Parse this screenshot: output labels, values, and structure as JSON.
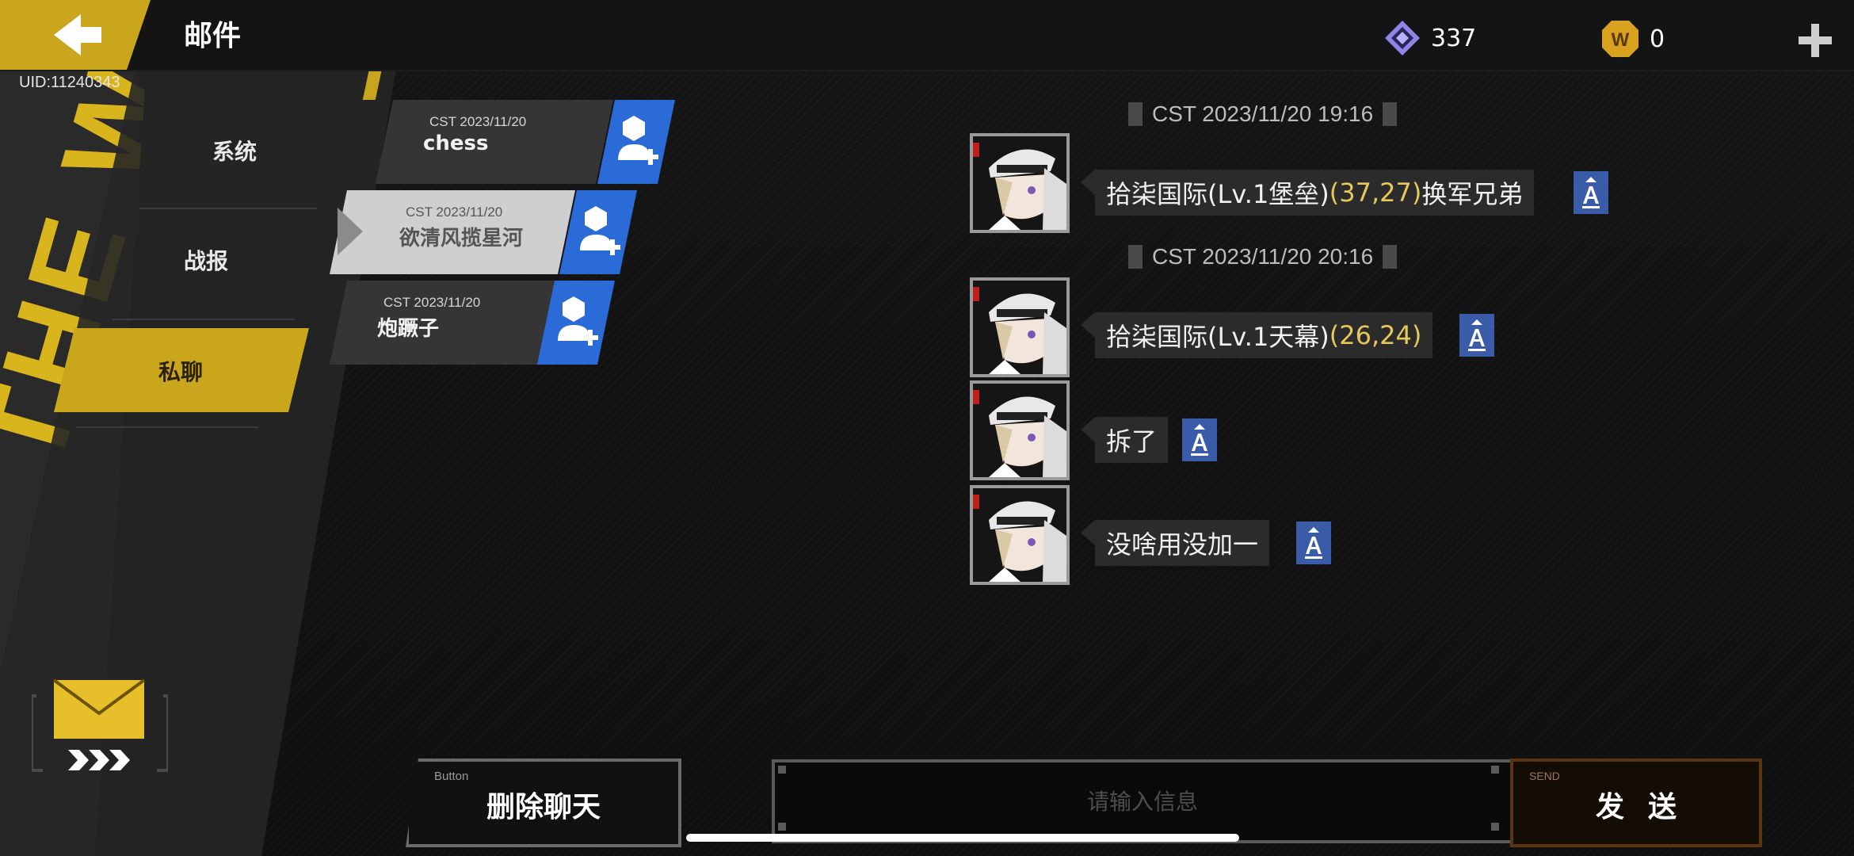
{
  "header": {
    "title": "邮件",
    "uid": "UID:11240343"
  },
  "currencies": [
    {
      "icon": "diamond-gem-icon",
      "value": "337"
    },
    {
      "icon": "w-coin-icon",
      "value": "0"
    }
  ],
  "nav": {
    "items": [
      {
        "label": "系统"
      },
      {
        "label": "战报"
      },
      {
        "label": "私聊",
        "active": true
      }
    ]
  },
  "contacts": [
    {
      "date": "CST 2023/11/20",
      "name": "chess",
      "selected": false
    },
    {
      "date": "CST 2023/11/20",
      "name": "欲清风揽星河",
      "selected": true
    },
    {
      "date": "CST 2023/11/20",
      "name": "炮蹶子",
      "selected": false
    }
  ],
  "chat": {
    "timestamps": [
      "CST 2023/11/20 19:16",
      "CST 2023/11/20 20:16"
    ],
    "messages": [
      {
        "pre": "拾柒国际(Lv.1堡垒)",
        "coord": "(37,27)",
        "post": "换军兄弟"
      },
      {
        "pre": "拾柒国际(Lv.1天幕)",
        "coord": "(26,24)",
        "post": ""
      },
      {
        "pre": "拆了",
        "coord": "",
        "post": ""
      },
      {
        "pre": "没啥用没加一",
        "coord": "",
        "post": ""
      }
    ]
  },
  "footer": {
    "delete_tag": "Button",
    "delete_label": "删除聊天",
    "input_placeholder": "请输入信息",
    "send_tag": "SEND",
    "send_label": "发送"
  },
  "wall_text": "THE WAR",
  "colors": {
    "accent_yellow": "#c9a61b",
    "add_blue": "#2b6bd8",
    "translate_blue": "#3a5ba8",
    "coord_yellow": "#e7c85a"
  }
}
